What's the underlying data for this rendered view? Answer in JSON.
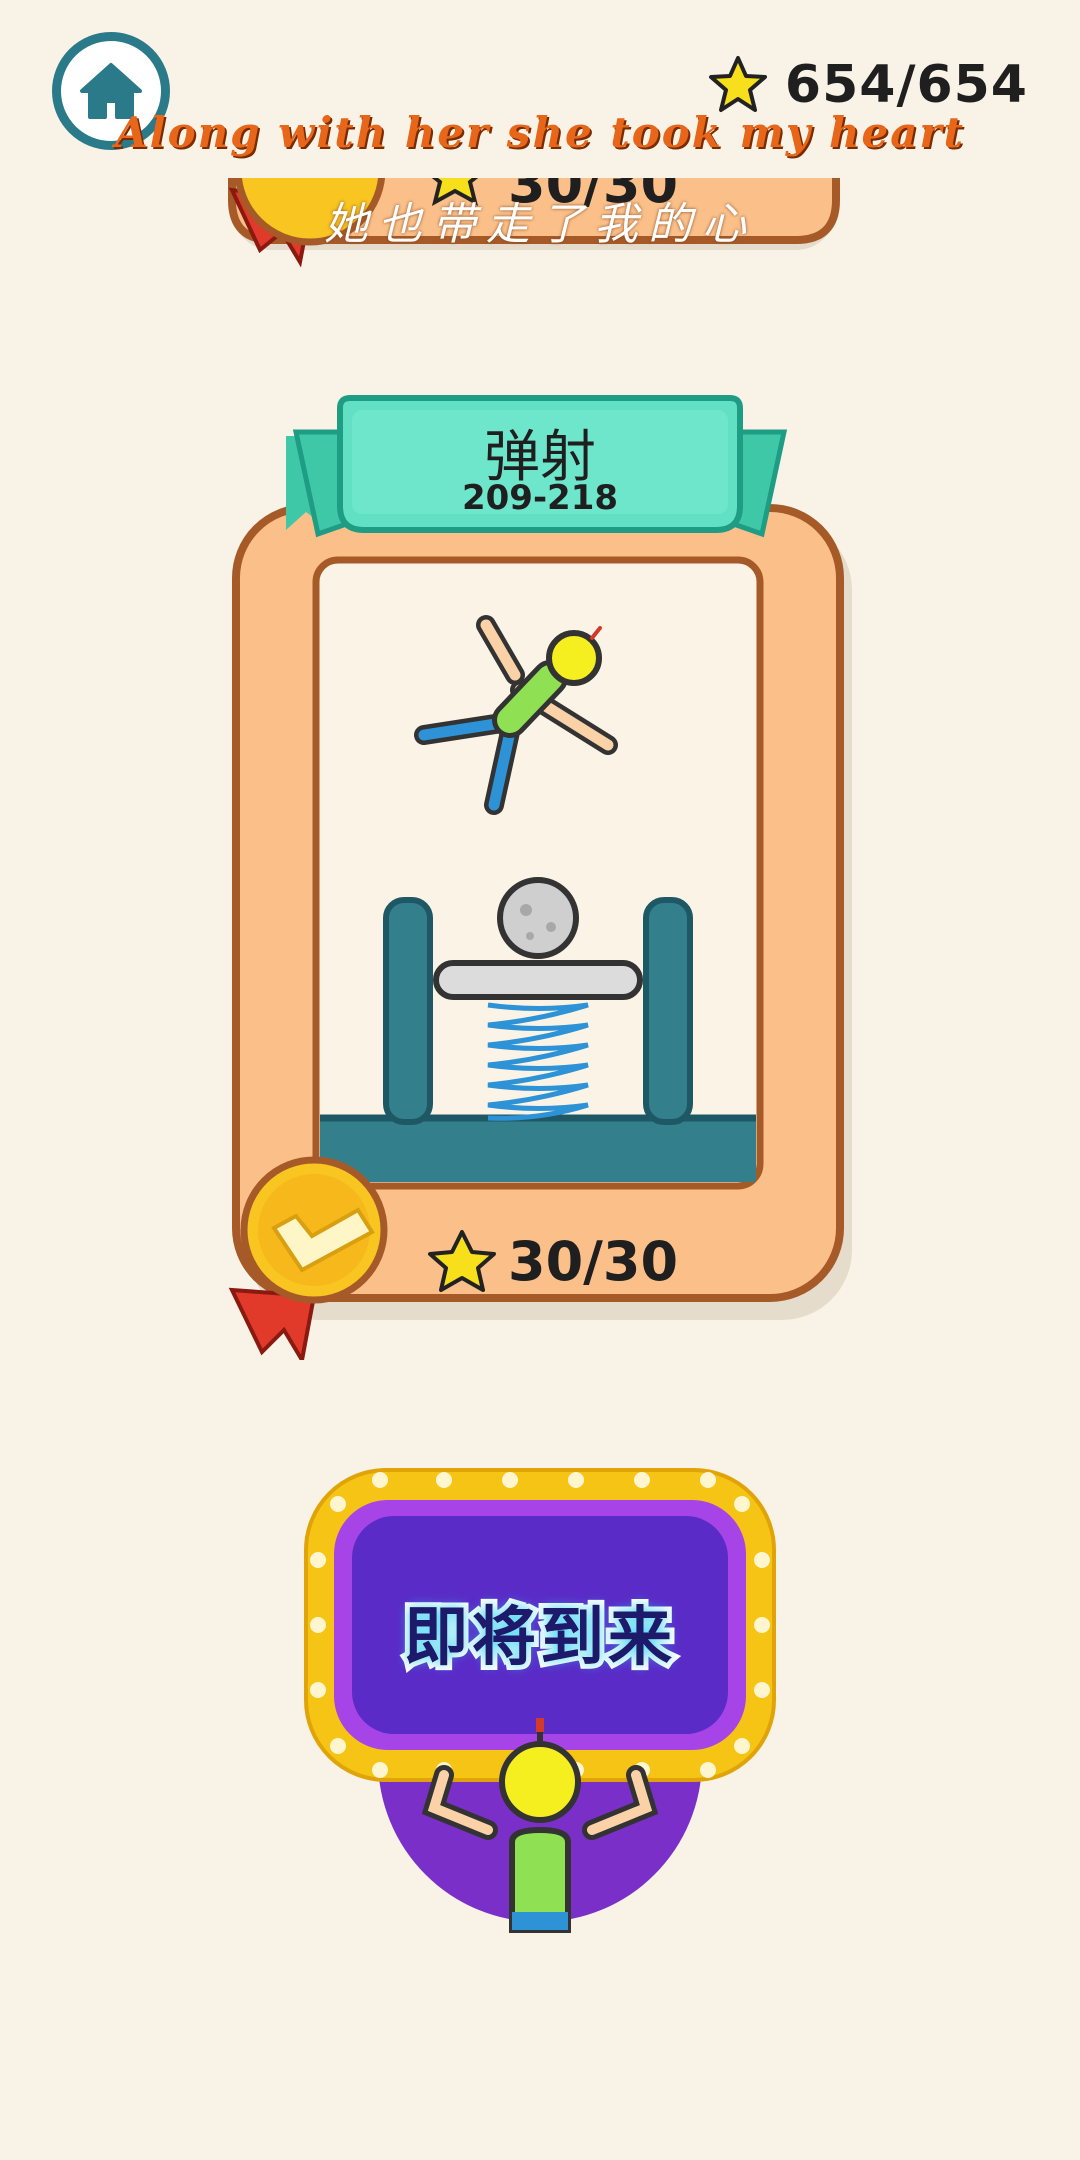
{
  "header": {
    "home_icon": "home-icon",
    "star_icon": "star-icon",
    "stars_total": "654/654"
  },
  "lyrics": {
    "line1": "Along with her she took my heart",
    "line2": "她也带走了我的心"
  },
  "previous_card": {
    "stars": "30/30"
  },
  "level_card": {
    "title": "弹射",
    "range": "209-218",
    "stars": "30/30",
    "completed_medal_icon": "checkmark-medal-icon"
  },
  "coming_soon": {
    "label": "即将到来"
  },
  "colors": {
    "background": "#f8f3e6",
    "card_frame": "#fbc08a",
    "card_border": "#a65a28",
    "ribbon": "#62e0c4",
    "teal_floor": "#337f8c",
    "marquee_gold": "#f5c415",
    "marquee_purple": "#5a2bc7"
  }
}
